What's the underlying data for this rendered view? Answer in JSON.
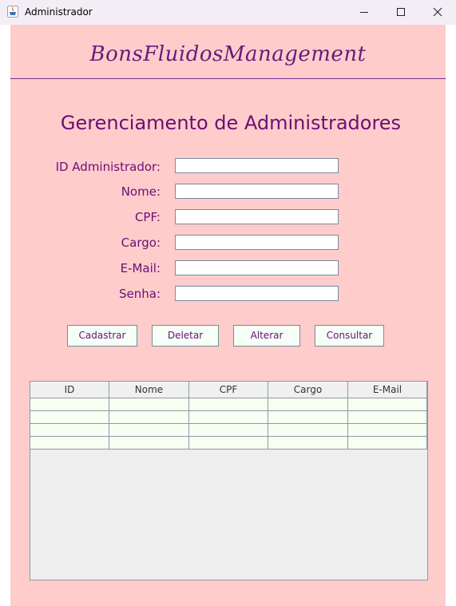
{
  "window": {
    "title": "Administrador"
  },
  "brand": "BonsFluidosManagement",
  "heading": "Gerenciamento de Administradores",
  "form": {
    "fields": [
      {
        "label": "ID Administrador:",
        "value": ""
      },
      {
        "label": "Nome:",
        "value": ""
      },
      {
        "label": "CPF:",
        "value": ""
      },
      {
        "label": "Cargo:",
        "value": ""
      },
      {
        "label": "E-Mail:",
        "value": ""
      },
      {
        "label": "Senha:",
        "value": ""
      }
    ]
  },
  "buttons": {
    "cadastrar": "Cadastrar",
    "deletar": "Deletar",
    "alterar": "Alterar",
    "consultar": "Consultar"
  },
  "table": {
    "columns": [
      "ID",
      "Nome",
      "CPF",
      "Cargo",
      "E-Mail"
    ],
    "rows": [
      [
        "",
        "",
        "",
        "",
        ""
      ],
      [
        "",
        "",
        "",
        "",
        ""
      ],
      [
        "",
        "",
        "",
        "",
        ""
      ],
      [
        "",
        "",
        "",
        "",
        ""
      ]
    ]
  },
  "colors": {
    "background": "#ffcccc",
    "accent": "#6a0f73",
    "button_bg": "#f5fff8",
    "row_bg": "#f7fff2"
  },
  "icons": {
    "app": "java-cup-icon",
    "minimize": "minimize-icon",
    "maximize": "maximize-icon",
    "close": "close-icon"
  }
}
